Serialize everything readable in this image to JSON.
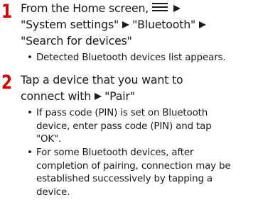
{
  "steps": [
    {
      "number": "1",
      "line1_text": "From the Home screen,",
      "line1_icon": "menu-icon",
      "line2_a": "\"System settings\"",
      "line2_b": "\"Bluetooth\"",
      "line3": "\"Search for devices\"",
      "bullets": [
        {
          "lines": [
            "Detected Bluetooth devices list appears."
          ]
        }
      ]
    },
    {
      "number": "2",
      "line1_text": "Tap a device that you want to",
      "line2_a": "connect with",
      "line2_b": "\"Pair\"",
      "bullets": [
        {
          "lines": [
            "If pass code (PIN) is set on Bluetooth",
            "device, enter pass code (PIN) and tap",
            "\"OK\"."
          ]
        },
        {
          "lines": [
            "For some Bluetooth devices, after",
            "completion of pairing, connection may be",
            "established successively by tapping a",
            "device."
          ]
        }
      ]
    }
  ],
  "bullet_glyph": "•",
  "colors": {
    "step_number": "#cc0000",
    "text": "#1a1a1a"
  }
}
